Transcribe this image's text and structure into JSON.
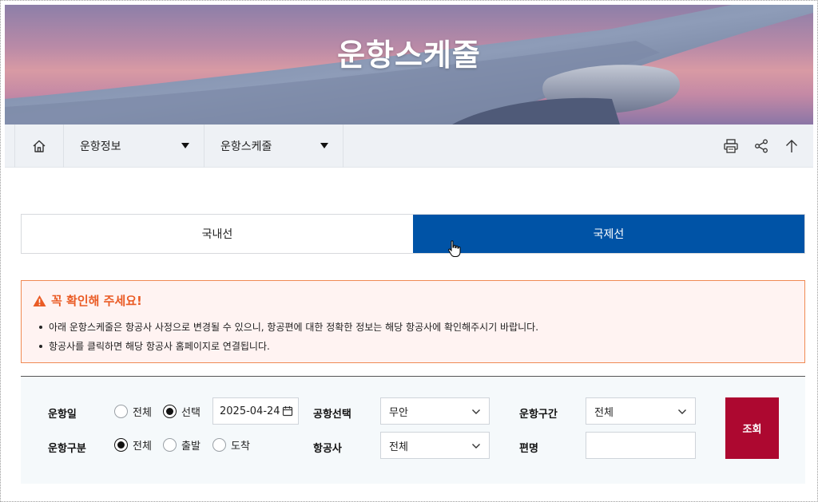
{
  "hero": {
    "title": "운항스케줄"
  },
  "nav": {
    "home_icon": "home-icon",
    "menu1_label": "운항정보",
    "menu2_label": "운항스케줄",
    "tools": [
      "print-icon",
      "share-icon",
      "arrow-up-icon"
    ]
  },
  "tabs": [
    {
      "label": "국내선",
      "active": false
    },
    {
      "label": "국제선",
      "active": true
    }
  ],
  "notice": {
    "title": "꼭 확인해 주세요!",
    "items": [
      "아래 운항스케줄은 항공사 사정으로 변경될 수 있으니, 항공편에 대한 정확한 정보는 해당 항공사에 확인해주시기 바랍니다.",
      "항공사를 클릭하면 해당 항공사 홈페이지로 연결됩니다."
    ]
  },
  "search": {
    "date_label": "운항일",
    "date_options": [
      "전체",
      "선택"
    ],
    "date_selected": "선택",
    "date_value": "2025-04-24",
    "type_label": "운항구분",
    "type_options": [
      "전체",
      "출발",
      "도착"
    ],
    "type_selected": "전체",
    "airport_label": "공항선택",
    "airport_value": "무안",
    "airline_label": "항공사",
    "airline_value": "전체",
    "route_label": "운항구간",
    "route_value": "전체",
    "flight_label": "편명",
    "flight_value": "",
    "submit_label": "조회"
  },
  "colors": {
    "tab_active": "#0053a6",
    "notice_accent": "#ea5b25",
    "submit_button": "#ad0830"
  }
}
